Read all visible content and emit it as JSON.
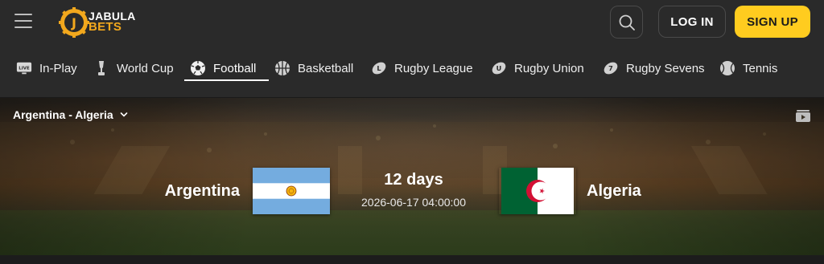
{
  "header": {
    "logo_line1": "JABULA",
    "logo_line2": "BETS",
    "login_label": "LOG IN",
    "signup_label": "SIGN UP",
    "brand_color": "#ffcc1f",
    "logo_color": "#f2a81d"
  },
  "sports_nav": {
    "items": [
      {
        "label": "In-Play",
        "icon": "live-tv-icon"
      },
      {
        "label": "World Cup",
        "icon": "trophy-icon"
      },
      {
        "label": "Football",
        "icon": "soccer-ball-icon",
        "active": true
      },
      {
        "label": "Basketball",
        "icon": "basketball-icon"
      },
      {
        "label": "Rugby League",
        "icon": "rugby-league-icon"
      },
      {
        "label": "Rugby Union",
        "icon": "rugby-union-icon"
      },
      {
        "label": "Rugby Sevens",
        "icon": "rugby-sevens-icon"
      },
      {
        "label": "Tennis",
        "icon": "tennis-ball-icon"
      }
    ],
    "live_badge": "LIVE",
    "more_label": "•••"
  },
  "event": {
    "selector_label": "Argentina - Algeria",
    "home_team": "Argentina",
    "away_team": "Algeria",
    "countdown": "12 days",
    "kickoff": "2026-06-17 04:00:00"
  }
}
